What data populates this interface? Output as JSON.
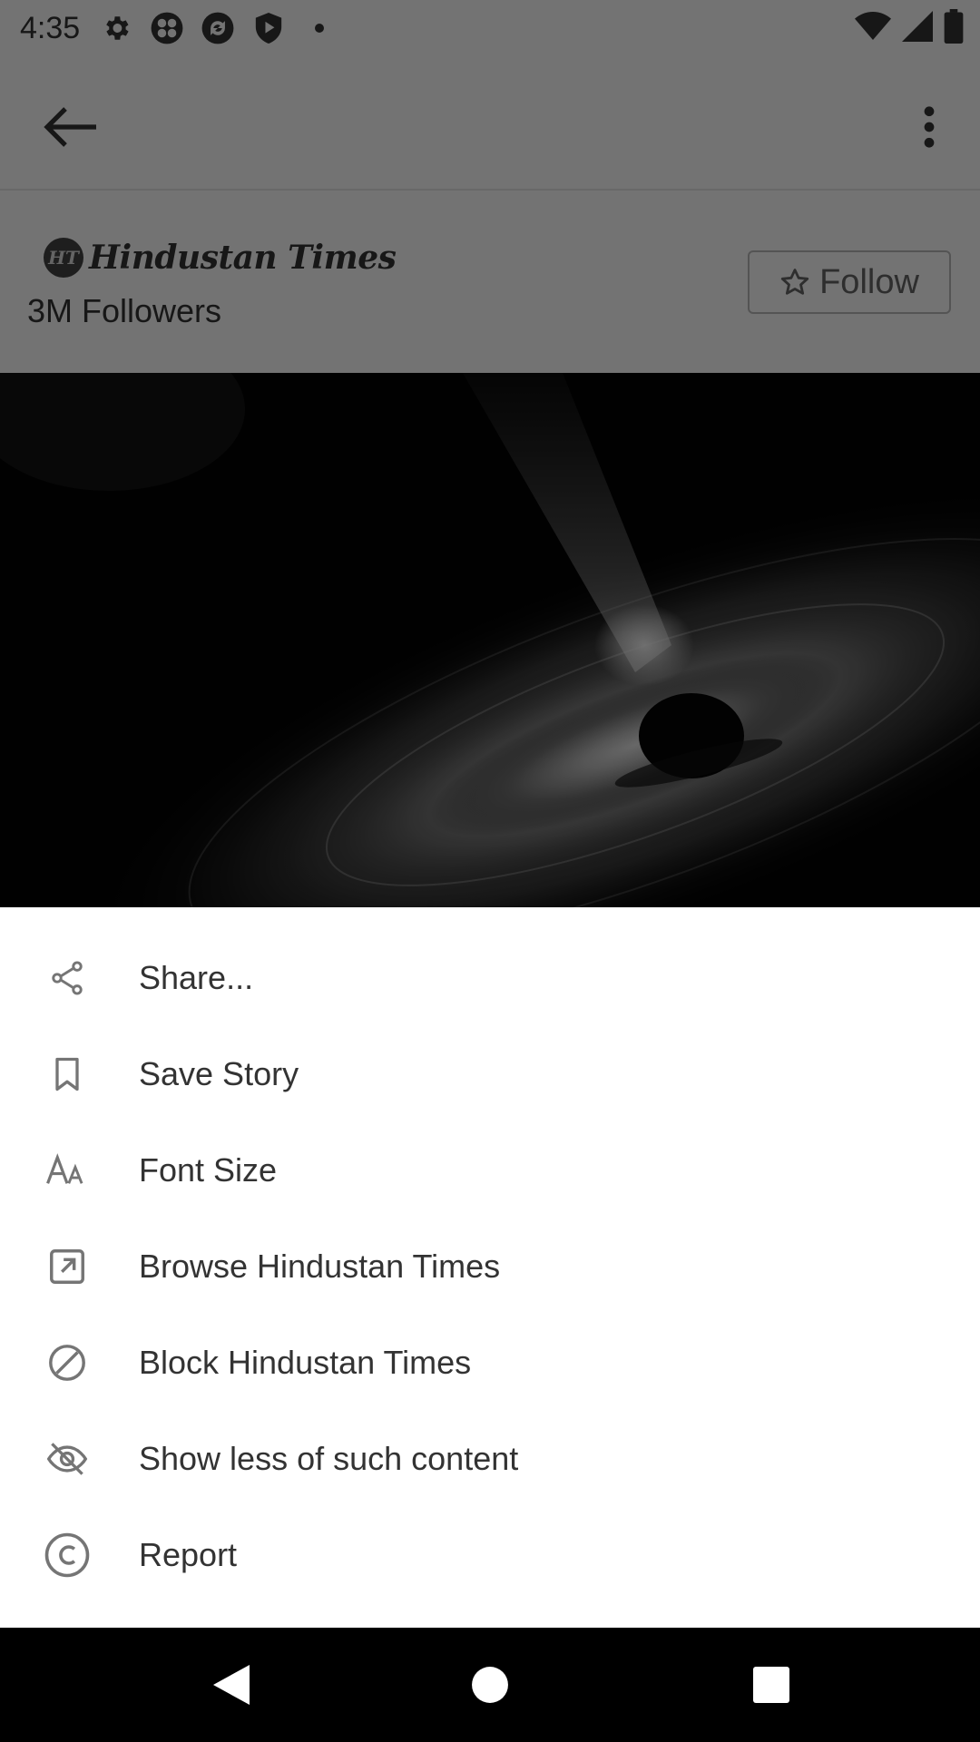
{
  "status_bar": {
    "time": "4:35",
    "left_icons": [
      "settings-icon",
      "app-icon",
      "sync-icon",
      "shield-play-icon",
      "dot-icon"
    ],
    "right_icons": [
      "wifi-icon",
      "signal-icon",
      "battery-icon"
    ]
  },
  "app_bar": {
    "back_icon": "arrow-back-icon",
    "more_icon": "more-vert-icon"
  },
  "publisher": {
    "logo_badge": "HT",
    "logo_text": "Hindustan Times",
    "followers": "3M Followers",
    "follow_label": "Follow",
    "follow_icon": "star-outline-icon"
  },
  "hero": {
    "image": "black-hole-illustration"
  },
  "menu": {
    "items": [
      {
        "label": "Share...",
        "icon": "share-icon"
      },
      {
        "label": "Save Story",
        "icon": "bookmark-icon"
      },
      {
        "label": "Font Size",
        "icon": "font-size-icon"
      },
      {
        "label": "Browse Hindustan Times",
        "icon": "open-external-icon"
      },
      {
        "label": "Block Hindustan Times",
        "icon": "block-icon"
      },
      {
        "label": "Show less of such content",
        "icon": "eye-off-icon"
      },
      {
        "label": "Report",
        "icon": "copyright-icon"
      }
    ]
  },
  "nav_bar": {
    "buttons": [
      "back-triangle-icon",
      "home-circle-icon",
      "recents-square-icon"
    ]
  },
  "colors": {
    "scrim": "#000000",
    "sheet_background": "#ffffff",
    "icon_gray": "#757575",
    "nav_bar": "#000000"
  }
}
